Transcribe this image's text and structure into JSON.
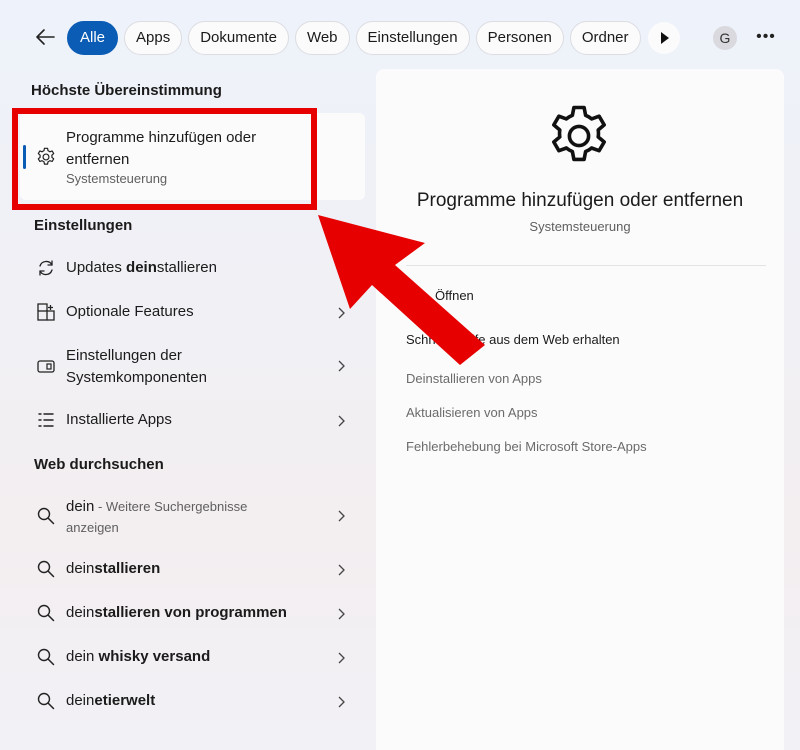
{
  "colors": {
    "accent": "#0b5cb5",
    "annotation": "#e60000"
  },
  "topbar": {
    "back_icon": "arrow-left-icon",
    "chips": [
      "Alle",
      "Apps",
      "Dokumente",
      "Web",
      "Einstellungen",
      "Personen",
      "Ordner"
    ],
    "active_chip": "Alle",
    "play_icon": "play-icon",
    "avatar_initial": "G",
    "more_label": "•••"
  },
  "best_match": {
    "heading": "Höchste Übereinstimmung",
    "name": "Programme hinzufügen oder entfernen",
    "source": "Systemsteuerung",
    "icon": "gear-icon"
  },
  "settings": {
    "heading": "Einstellungen",
    "items": [
      {
        "pre": "Updates ",
        "bold": "dein",
        "post": "stallieren",
        "icon": "refresh-icon"
      },
      {
        "pre": "Optionale Features",
        "bold": "",
        "post": "",
        "icon": "add-feature-icon"
      },
      {
        "pre": "Einstellungen der Systemkomponenten",
        "bold": "",
        "post": "",
        "icon": "component-icon"
      },
      {
        "pre": "Installierte Apps",
        "bold": "",
        "post": "",
        "icon": "app-list-icon"
      }
    ]
  },
  "web": {
    "heading": "Web durchsuchen",
    "first": {
      "query": "dein",
      "suffix": " - Weitere Suchergebnisse anzeigen"
    },
    "items": [
      {
        "pre": "dein",
        "bold": "stallieren"
      },
      {
        "pre": "dein",
        "bold": "stallieren von programmen"
      },
      {
        "pre": "dein",
        "bold": " whisky versand"
      },
      {
        "pre": "dein",
        "bold": "etierwelt"
      }
    ]
  },
  "preview": {
    "title": "Programme hinzufügen oder entfernen",
    "subtitle": "Systemsteuerung",
    "open_label": "Öffnen",
    "help_label": "Schnelle Hilfe aus dem Web erhalten",
    "links": [
      "Deinstallieren von Apps",
      "Aktualisieren von Apps",
      "Fehlerbehebung bei Microsoft Store-Apps"
    ]
  }
}
